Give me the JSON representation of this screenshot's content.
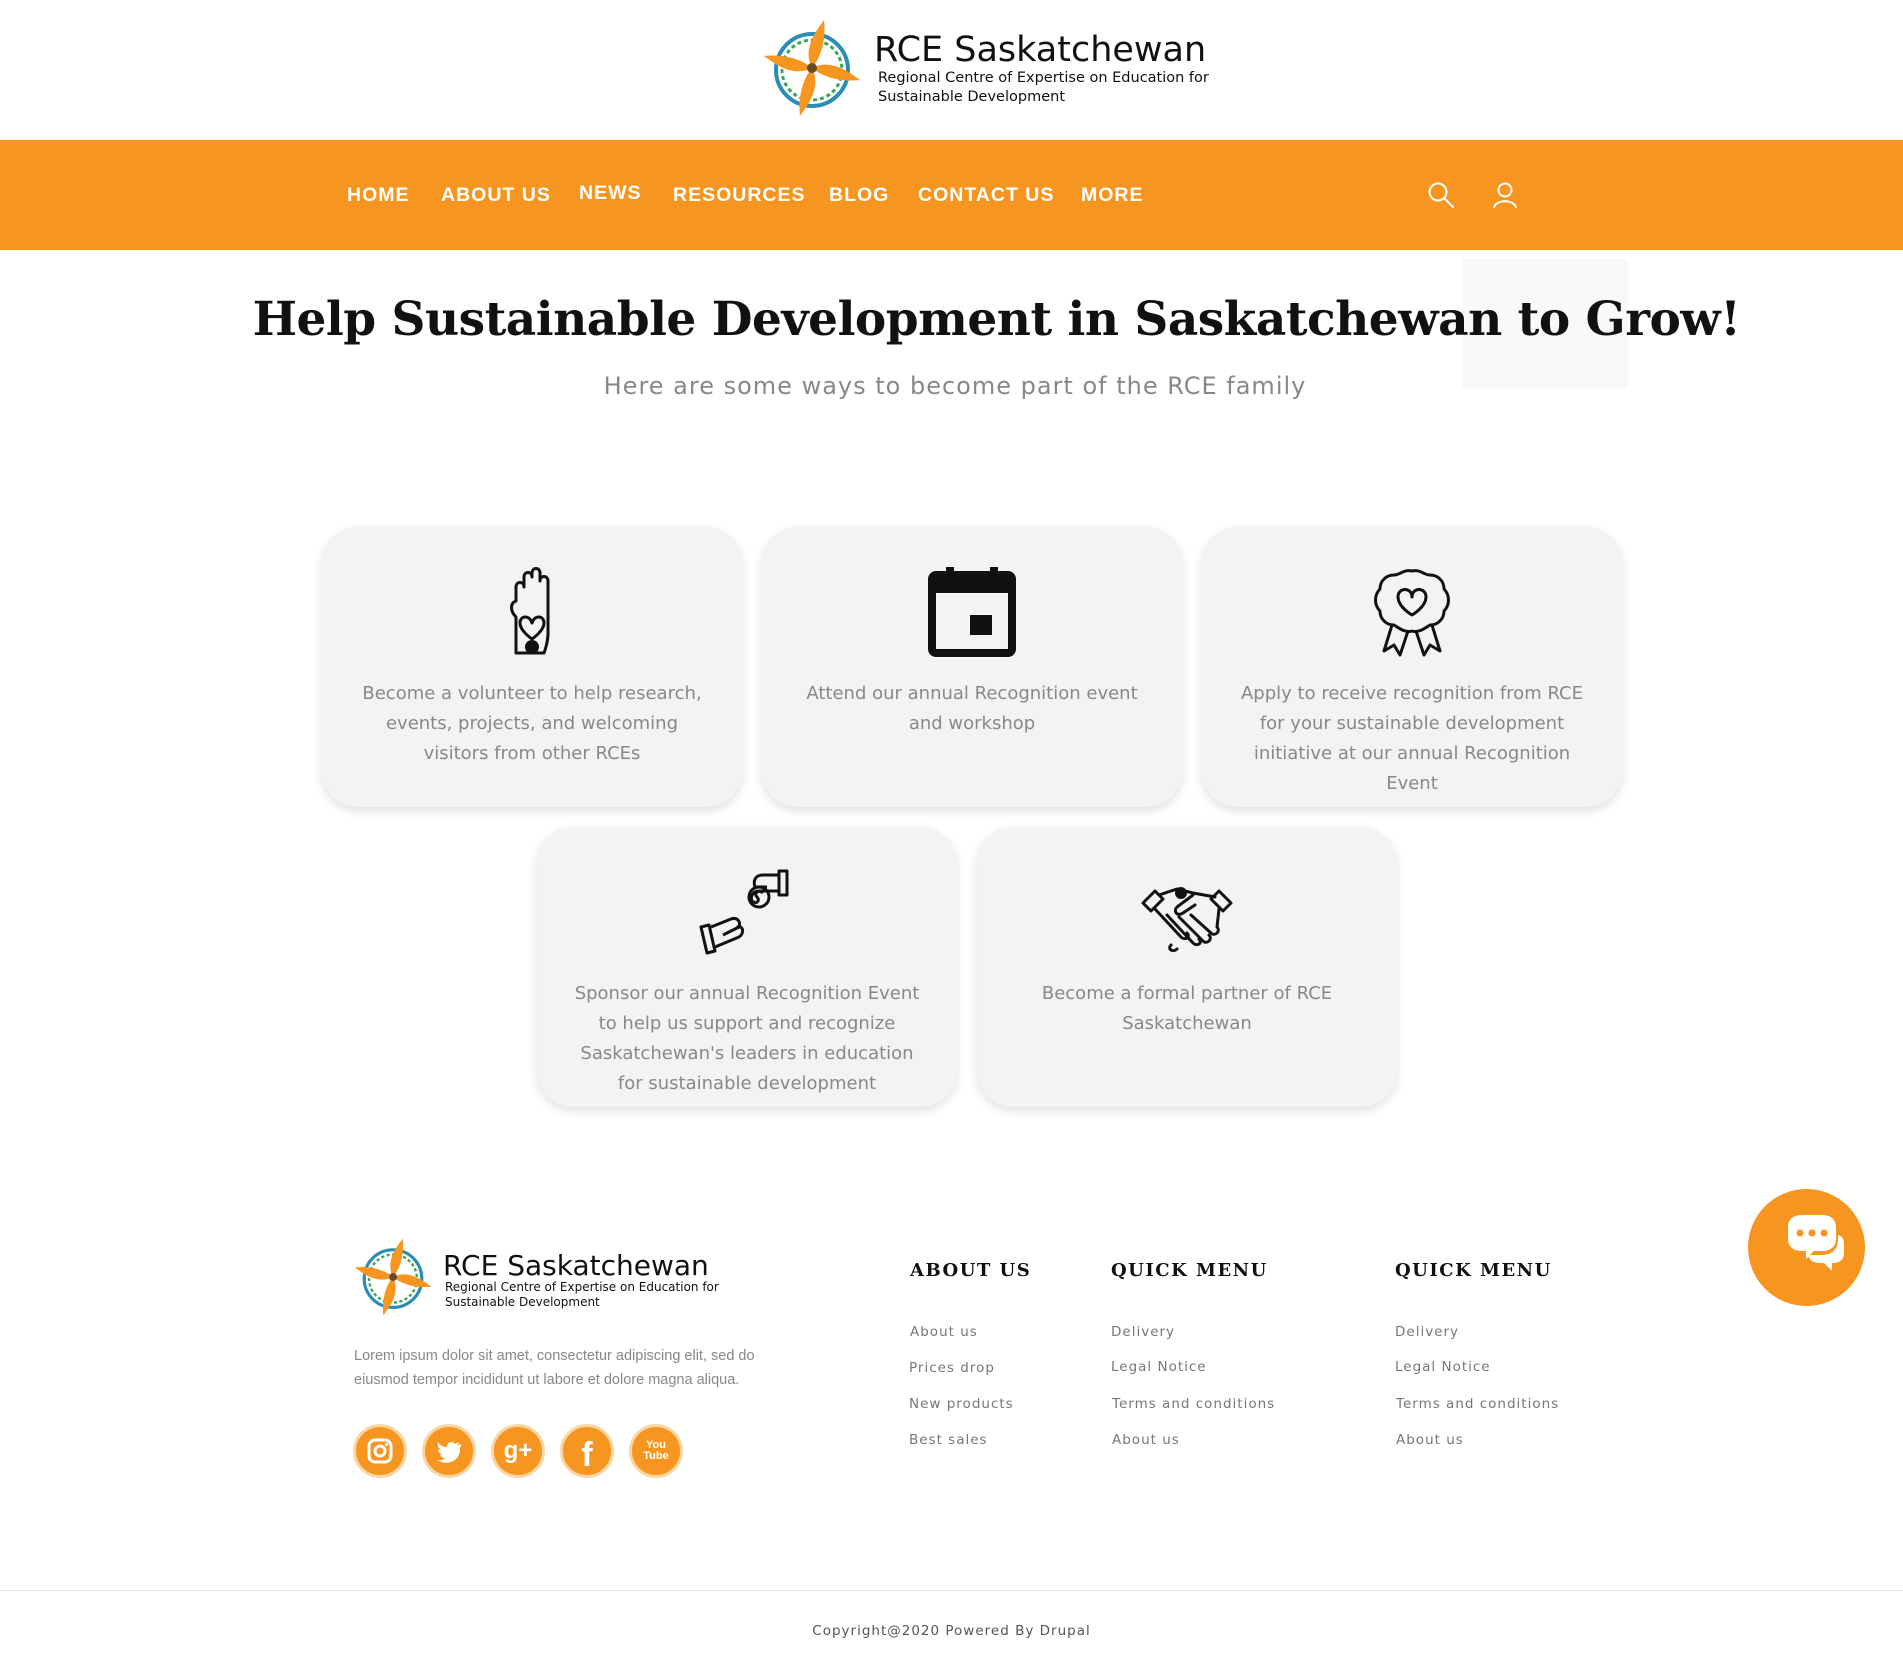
{
  "brand": {
    "title": "RCE Saskatchewan",
    "subtitle": "Regional Centre of Expertise on Education for Sustainable Development",
    "accent_color": "#f6951f"
  },
  "nav": {
    "items": [
      {
        "label": "HOME"
      },
      {
        "label": "ABOUT US"
      },
      {
        "label": "NEWS"
      },
      {
        "label": "RESOURCES"
      },
      {
        "label": "BLOG"
      },
      {
        "label": "CONTACT US"
      },
      {
        "label": "MORE"
      }
    ],
    "icons": [
      "search-icon",
      "user-icon"
    ]
  },
  "hero": {
    "title": "Help Sustainable Development in Saskatchewan to Grow!",
    "subtitle": "Here are some ways to become part of the RCE family"
  },
  "cards": [
    {
      "icon": "volunteer-hand-heart-icon",
      "text": "Become a volunteer to help research, events, projects, and welcoming visitors from other RCEs"
    },
    {
      "icon": "calendar-event-icon",
      "text": "Attend our annual Recognition event and workshop"
    },
    {
      "icon": "award-ribbon-heart-icon",
      "text": "Apply to receive recognition from RCE for your sustainable development initiative at our annual Recognition Event"
    },
    {
      "icon": "sponsor-money-hands-icon",
      "text": "Sponsor our annual Recognition Event to help us support and recognize Saskatchewan's leaders in education for sustainable development"
    },
    {
      "icon": "handshake-icon",
      "text": "Become a formal partner of RCE Saskatchewan"
    }
  ],
  "footer": {
    "description": "Lorem ipsum dolor sit amet, consectetur adipiscing elit, sed do eiusmod tempor incididunt ut labore et dolore magna aliqua.",
    "social": [
      {
        "icon": "instagram-icon"
      },
      {
        "icon": "twitter-icon"
      },
      {
        "icon": "google-plus-icon",
        "label": "g+"
      },
      {
        "icon": "facebook-icon",
        "label": "f"
      },
      {
        "icon": "youtube-icon",
        "label": "You Tube"
      }
    ],
    "columns": [
      {
        "title": "ABOUT US",
        "links": [
          "About us",
          "Prices drop",
          "New products",
          "Best sales"
        ]
      },
      {
        "title": "QUICK MENU",
        "links": [
          "Delivery",
          "Legal Notice",
          "Terms and conditions",
          "About us"
        ]
      },
      {
        "title": "QUICK MENU",
        "links": [
          "Delivery",
          "Legal Notice",
          "Terms and conditions",
          "About us"
        ]
      }
    ],
    "copyright": "Copyright@2020 Powered By Drupal"
  },
  "chat": {
    "icon": "chat-bubbles-icon"
  }
}
